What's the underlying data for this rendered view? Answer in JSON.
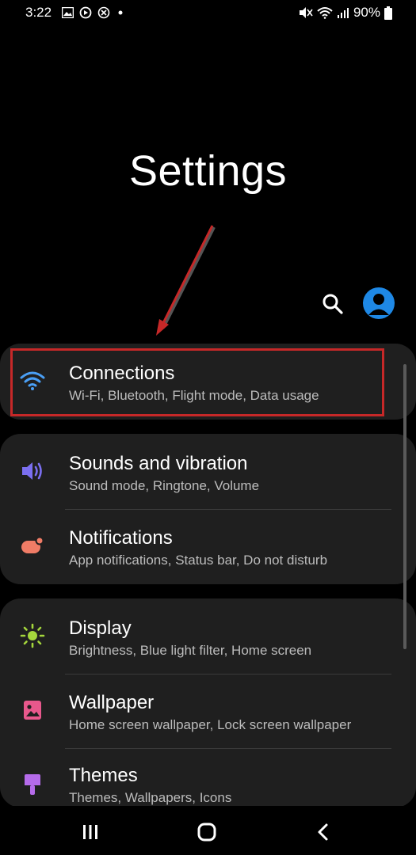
{
  "status_bar": {
    "time": "3:22",
    "battery_text": "90%",
    "left_icons": [
      "image-icon",
      "sync-icon",
      "close-circle-icon",
      "dot-icon"
    ],
    "right_icons": [
      "mute-icon",
      "wifi-icon",
      "signal-icon",
      "battery-icon"
    ]
  },
  "header": {
    "title": "Settings",
    "search_icon": "search-icon",
    "avatar_icon": "account-icon",
    "avatar_color": "#1e88e5"
  },
  "settings": {
    "connections": {
      "title": "Connections",
      "subtitle": "Wi-Fi, Bluetooth, Flight mode, Data usage",
      "icon": "wifi-icon",
      "color": "#4a9ff5"
    },
    "sounds": {
      "title": "Sounds and vibration",
      "subtitle": "Sound mode, Ringtone, Volume",
      "icon": "volume-icon",
      "color": "#7b6ff0"
    },
    "notifications": {
      "title": "Notifications",
      "subtitle": "App notifications, Status bar, Do not disturb",
      "icon": "notification-icon",
      "color": "#f07c66"
    },
    "display": {
      "title": "Display",
      "subtitle": "Brightness, Blue light filter, Home screen",
      "icon": "sun-icon",
      "color": "#a4d63c"
    },
    "wallpaper": {
      "title": "Wallpaper",
      "subtitle": "Home screen wallpaper, Lock screen wallpaper",
      "icon": "image-icon",
      "color": "#e8588c"
    },
    "themes": {
      "title": "Themes",
      "subtitle": "Themes, Wallpapers, Icons",
      "icon": "brush-icon",
      "color": "#b56bea"
    }
  },
  "annotation": {
    "color": "#c62828"
  },
  "nav_bar": {
    "buttons": [
      "recents-icon",
      "home-icon",
      "back-icon"
    ]
  }
}
